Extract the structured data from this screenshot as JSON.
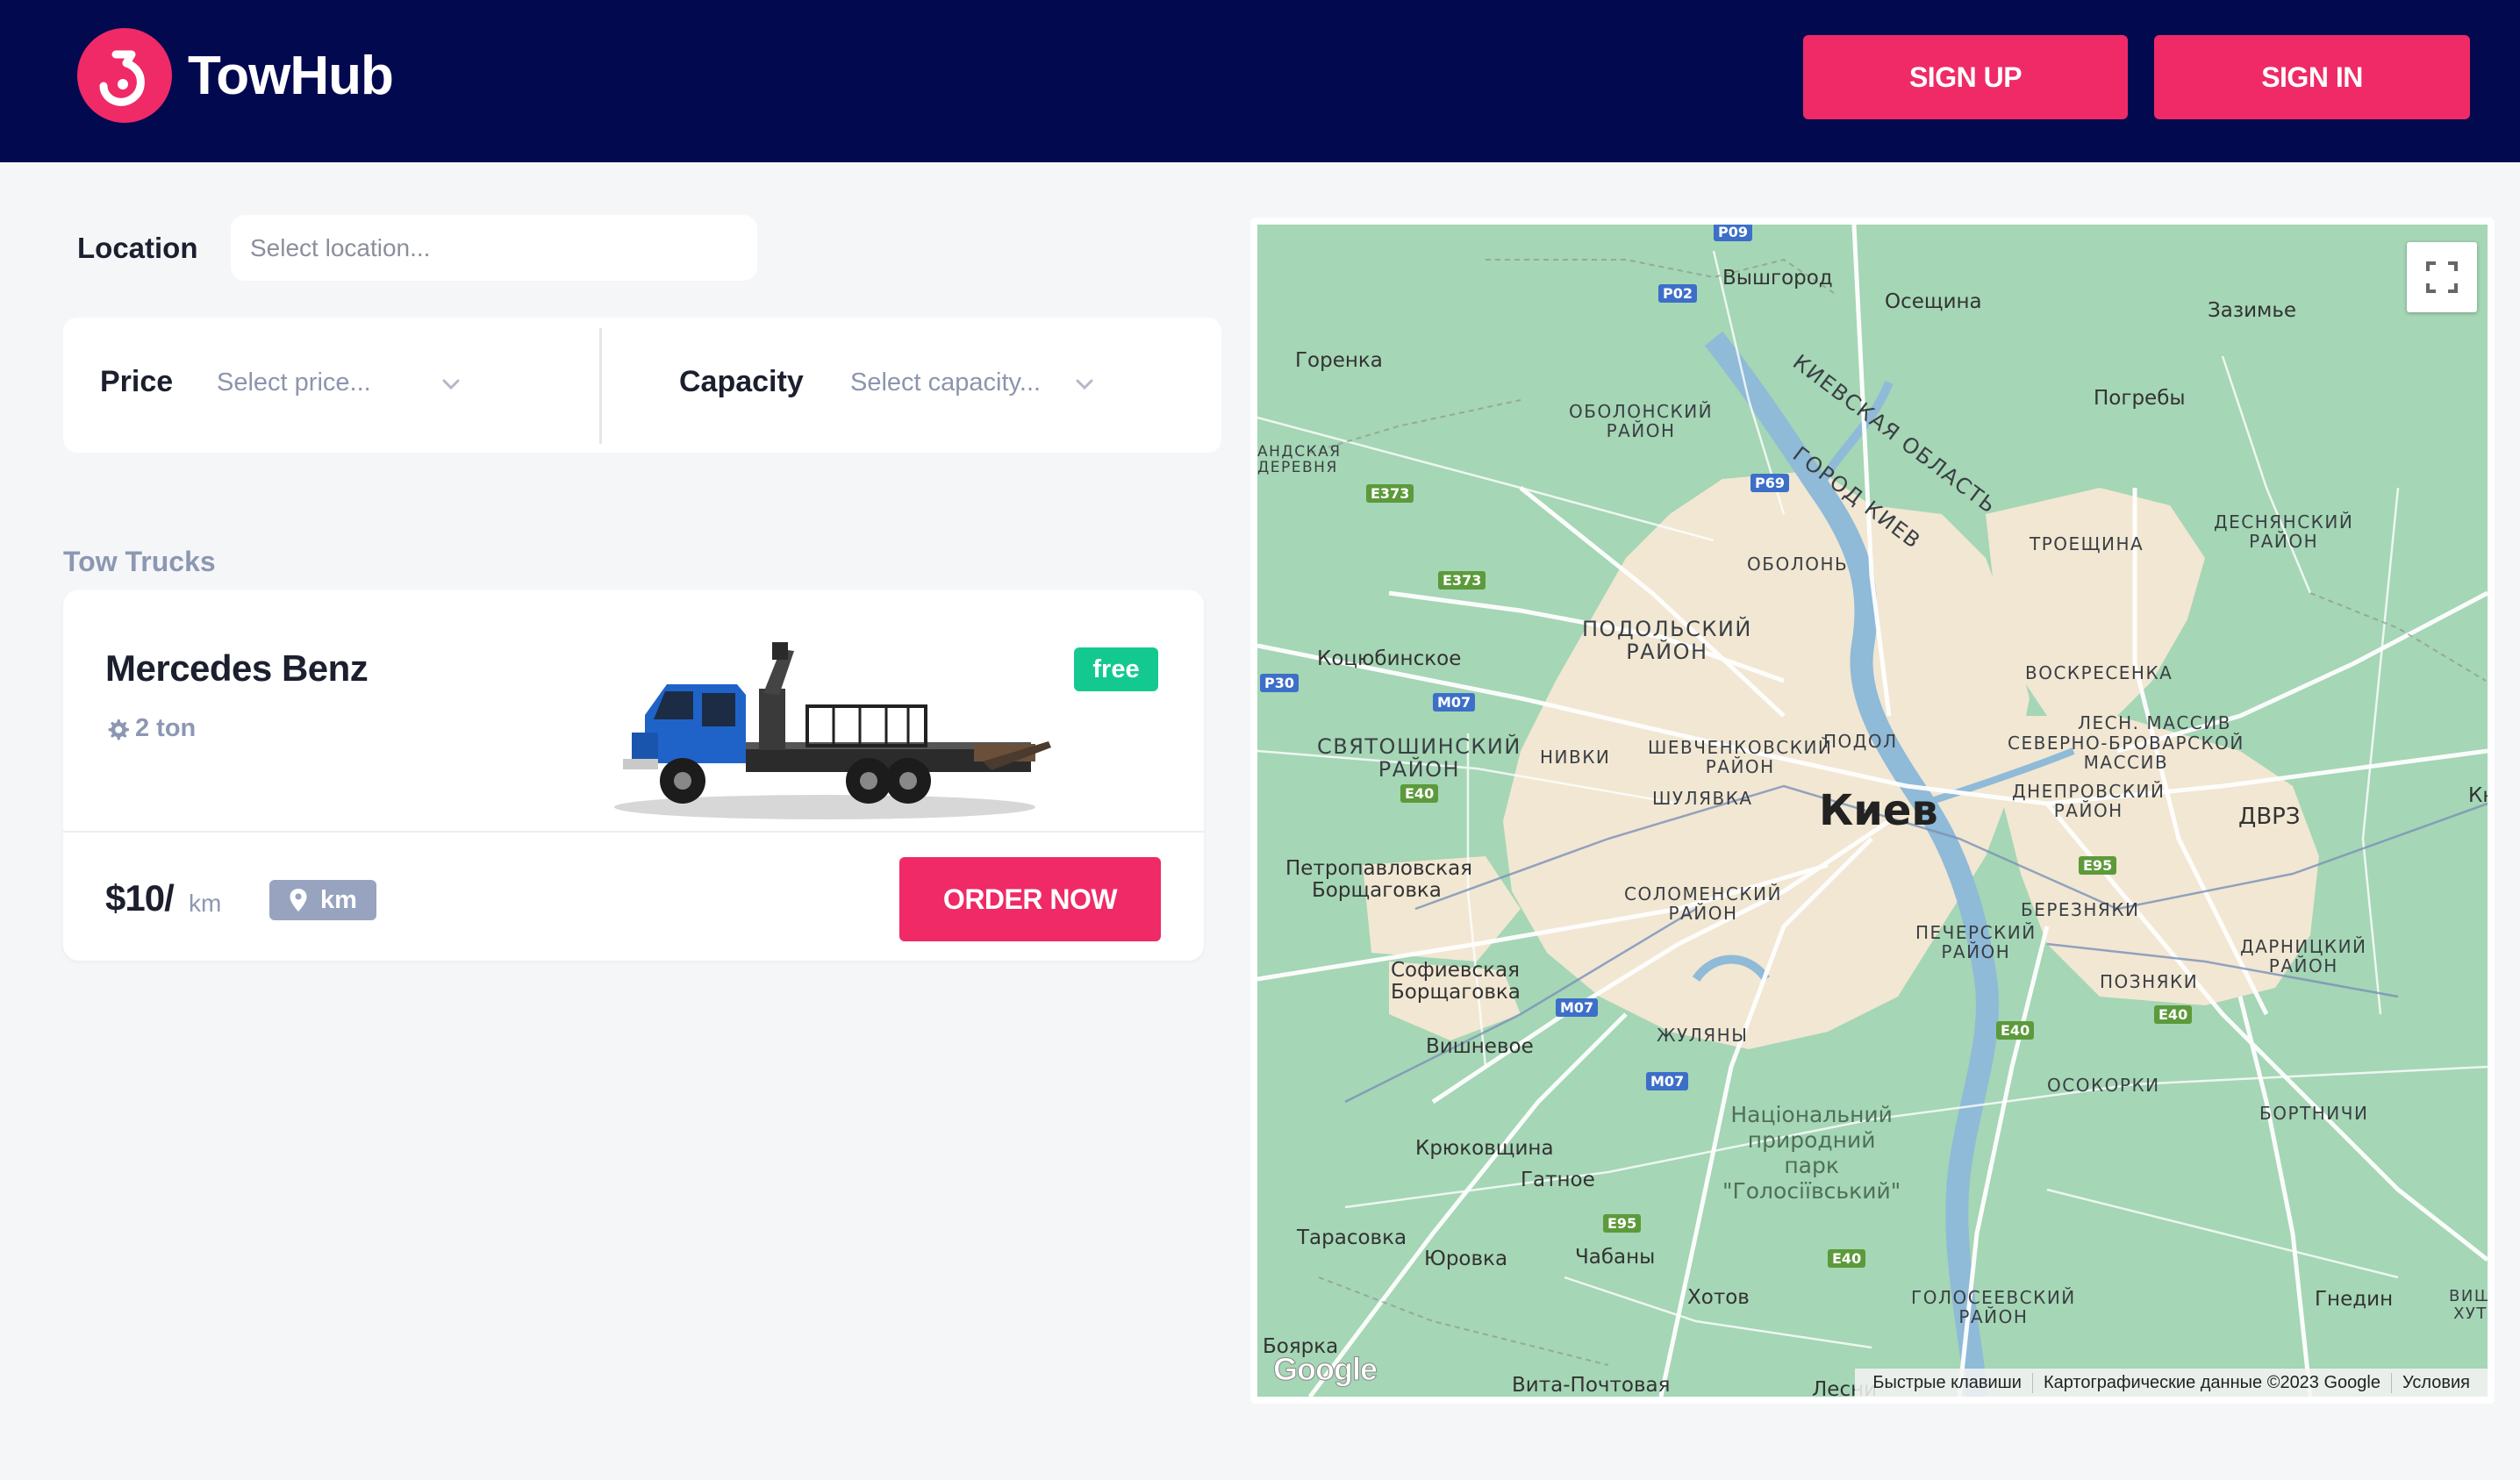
{
  "header": {
    "brand": "TowHub",
    "signup_label": "SIGN UP",
    "signin_label": "SIGN IN",
    "brand_color": "#ef2a67",
    "bg_color": "#03094f"
  },
  "filters": {
    "location_label": "Location",
    "location_placeholder": "Select location...",
    "price_label": "Price",
    "price_placeholder": "Select price...",
    "capacity_label": "Capacity",
    "capacity_placeholder": "Select capacity..."
  },
  "section_title": "Tow Trucks",
  "truck": {
    "name": "Mercedes Benz",
    "capacity": "2 ton",
    "status": "free",
    "price": "$10/",
    "price_unit": "km",
    "distance": "km",
    "order_label": "ORDER NOW",
    "status_color": "#14c98f"
  },
  "map": {
    "city": "Киев",
    "labels": {
      "vyshgorod": "Вышгород",
      "osesh": "Осещина",
      "zazim": "Зазимье",
      "gorenka": "Горенка",
      "pogreby": "Погребы",
      "obolon_r1": "ОБОЛОНСКИЙ",
      "obolon_r2": "РАЙОН",
      "kyiv_obl": "КИЕВСКАЯ ОБЛАСТЬ",
      "gorod_kiev": "ГОРОД КИЕВ",
      "andr1": "АНДСКАЯ",
      "andr2": "ДЕРЕВНЯ",
      "obolon": "ОБОЛОНЬ",
      "troesh": "ТРОЕЩИНА",
      "desn1": "ДЕСНЯНСКИЙ",
      "desn2": "РАЙОН",
      "podol_r1": "ПОДОЛЬСКИЙ",
      "podol_r2": "РАЙОН",
      "kotsyub": "Коцюбинское",
      "voskres": "ВОСКРЕСЕНКА",
      "lesn": "ЛЕСН. МАССИВ",
      "sev1": "СЕВЕРНО-БРОВАРСКОЙ",
      "sev2": "МАССИВ",
      "svyat1": "СВЯТОШИНСКИЙ",
      "svyat2": "РАЙОН",
      "nivki": "НИВКИ",
      "shev1": "ШЕВЧЕНКОВСКИЙ",
      "shev2": "РАЙОН",
      "podol": "ПОДОЛ",
      "shulyav": "ШУЛЯВКА",
      "dnepr1": "ДНЕПРОВСКИЙ",
      "dnepr2": "РАЙОН",
      "dvrz": "ДВРЗ",
      "kn": "Кн",
      "petro1": "Петропавловская",
      "petro2": "Борщаговка",
      "solom1": "СОЛОМЕНСКИЙ",
      "solom2": "РАЙОН",
      "berez": "БЕРЕЗНЯКИ",
      "pech1": "ПЕЧЕРСКИЙ",
      "pech2": "РАЙОН",
      "darn1": "ДАРНИЦКИЙ",
      "darn2": "РАЙОН",
      "sof1": "Софиевская",
      "sof2": "Борщаговка",
      "pozn": "ПОЗНЯКИ",
      "zhul": "ЖУЛЯНЫ",
      "vish": "Вишневое",
      "osok": "ОСОКОРКИ",
      "park1": "Національний",
      "park2": "природний",
      "park3": "парк",
      "park4": "\"Голосіївський\"",
      "bort": "БОРТНИЧИ",
      "kryuk": "Крюковщина",
      "gatn": "Гатное",
      "taras": "Тарасовка",
      "yurov": "Юровка",
      "chaban": "Чабаны",
      "khotov": "Хотов",
      "golos1": "ГОЛОСЕЕВСКИЙ",
      "golos2": "РАЙОН",
      "gnedin": "Гнедин",
      "vish1": "ВИШН",
      "vish2": "ХУТО",
      "boyarka": "Боярка",
      "vita": "Вита-Почтовая",
      "lesnik": "Лесни"
    },
    "shields": {
      "p09": "P09",
      "p02": "P02",
      "p69": "P69",
      "e373a": "E373",
      "e373b": "E373",
      "p30": "P30",
      "m07a": "M07",
      "e40a": "E40",
      "e95a": "E95",
      "m07b": "M07",
      "e40b": "E40",
      "e40c": "E40",
      "m07c": "M07",
      "e95b": "E95",
      "e40d": "E40"
    },
    "footer_shortcuts": "Быстрые клавиши",
    "footer_data": "Картографические данные ©2023 Google",
    "footer_terms": "Условия",
    "google": "Google"
  }
}
